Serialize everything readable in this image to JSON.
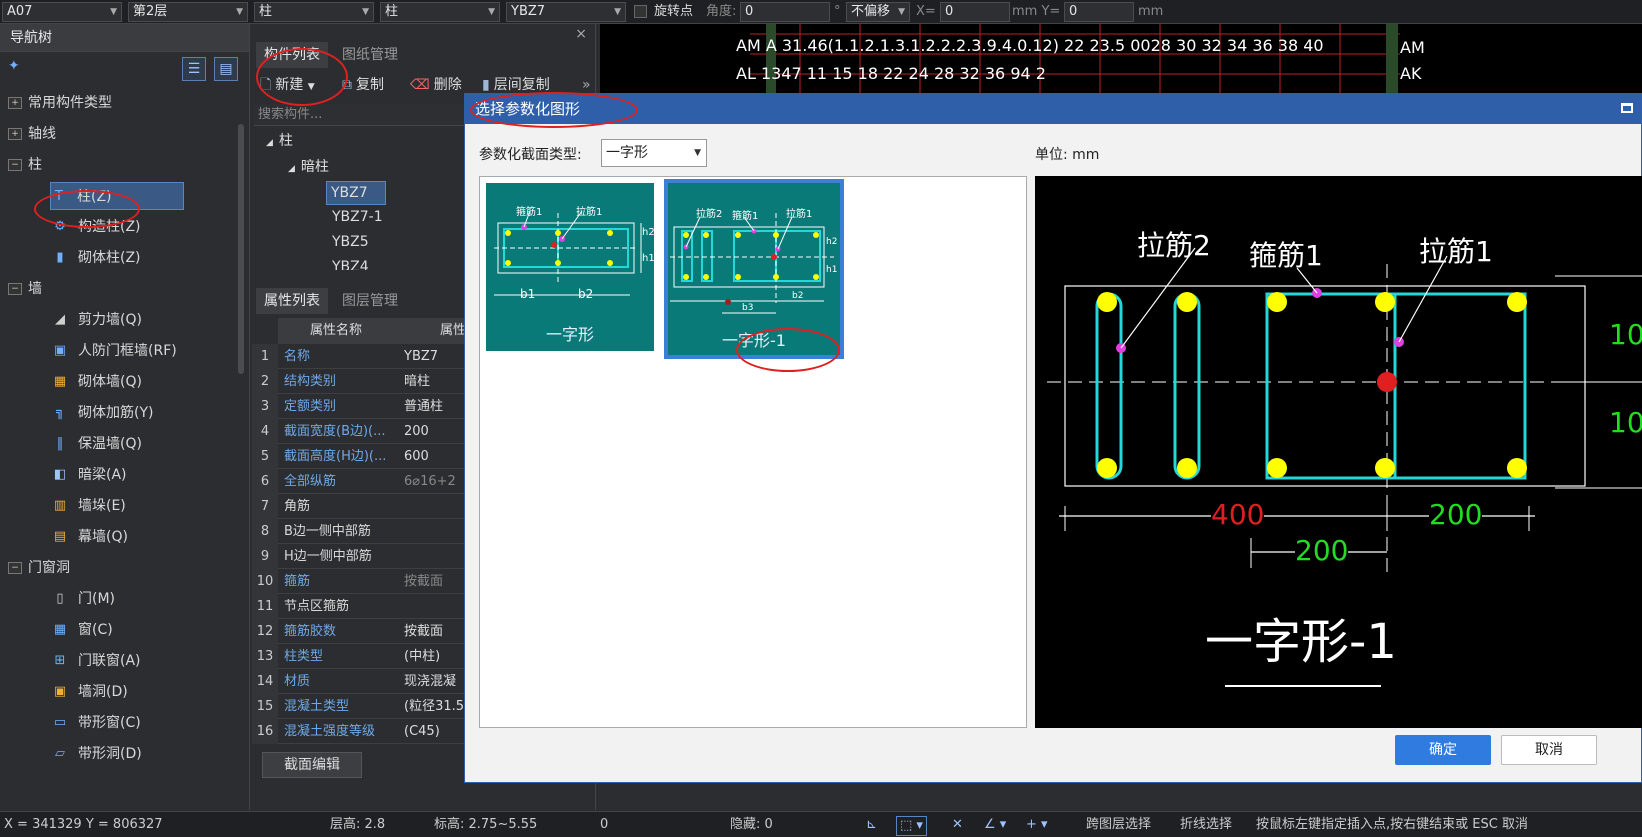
{
  "toolbar": {
    "floor_id": "A07",
    "floor": "第2层",
    "category": "柱",
    "subcategory": "柱",
    "component": "YBZ7",
    "rotate_label": "旋转点",
    "angle_label": "角度:",
    "angle_value": "0",
    "degree": "°",
    "offset_mode": "不偏移",
    "x_label": "X=",
    "x_value": "0",
    "mm_y_label": "mm Y=",
    "y_value": "0",
    "mm": "mm"
  },
  "nav": {
    "title": "导航树",
    "items": [
      {
        "label": "常用构件类型",
        "type": "group"
      },
      {
        "label": "轴线",
        "type": "group"
      },
      {
        "label": "柱",
        "type": "group"
      },
      {
        "label": "柱(Z)",
        "type": "leaf"
      },
      {
        "label": "构造柱(Z)",
        "type": "leaf"
      },
      {
        "label": "砌体柱(Z)",
        "type": "leaf"
      },
      {
        "label": "墙",
        "type": "group"
      },
      {
        "label": "剪力墙(Q)",
        "type": "leaf"
      },
      {
        "label": "人防门框墙(RF)",
        "type": "leaf"
      },
      {
        "label": "砌体墙(Q)",
        "type": "leaf"
      },
      {
        "label": "砌体加筋(Y)",
        "type": "leaf"
      },
      {
        "label": "保温墙(Q)",
        "type": "leaf"
      },
      {
        "label": "暗梁(A)",
        "type": "leaf"
      },
      {
        "label": "墙垛(E)",
        "type": "leaf"
      },
      {
        "label": "幕墙(Q)",
        "type": "leaf"
      },
      {
        "label": "门窗洞",
        "type": "group"
      },
      {
        "label": "门(M)",
        "type": "leaf"
      },
      {
        "label": "窗(C)",
        "type": "leaf"
      },
      {
        "label": "门联窗(A)",
        "type": "leaf"
      },
      {
        "label": "墙洞(D)",
        "type": "leaf"
      },
      {
        "label": "带形窗(C)",
        "type": "leaf"
      },
      {
        "label": "带形洞(D)",
        "type": "leaf"
      }
    ]
  },
  "component_panel": {
    "tab_active": "构件列表",
    "tab_other": "图纸管理",
    "close": "×",
    "btn_new": "新建",
    "btn_copy": "复制",
    "btn_delete": "删除",
    "btn_floor_copy": "层间复制",
    "more": "»",
    "search_placeholder": "搜索构件...",
    "tree_root": "柱",
    "tree_child": "暗柱",
    "items": [
      "YBZ7",
      "YBZ7-1",
      "YBZ5",
      "YBZ4"
    ]
  },
  "property_panel": {
    "tab_active": "属性列表",
    "tab_other": "图层管理",
    "col_name": "属性名称",
    "col_value": "属性",
    "rows": [
      {
        "n": "1",
        "k": "名称",
        "v": "YBZ7"
      },
      {
        "n": "2",
        "k": "结构类别",
        "v": "暗柱"
      },
      {
        "n": "3",
        "k": "定额类别",
        "v": "普通柱"
      },
      {
        "n": "4",
        "k": "截面宽度(B边)(...",
        "v": "200"
      },
      {
        "n": "5",
        "k": "截面高度(H边)(...",
        "v": "600"
      },
      {
        "n": "6",
        "k": "全部纵筋",
        "v": "6⌀16+2"
      },
      {
        "n": "7",
        "k": "角筋",
        "v": ""
      },
      {
        "n": "8",
        "k": "B边一侧中部筋",
        "v": ""
      },
      {
        "n": "9",
        "k": "H边一侧中部筋",
        "v": ""
      },
      {
        "n": "10",
        "k": "箍筋",
        "v": "按截面"
      },
      {
        "n": "11",
        "k": "节点区箍筋",
        "v": ""
      },
      {
        "n": "12",
        "k": "箍筋胶数",
        "v": "按截面"
      },
      {
        "n": "13",
        "k": "柱类型",
        "v": "(中柱)"
      },
      {
        "n": "14",
        "k": "材质",
        "v": "现浇混凝"
      },
      {
        "n": "15",
        "k": "混凝土类型",
        "v": "(粒径31.5"
      },
      {
        "n": "16",
        "k": "混凝土强度等级",
        "v": "(C45)"
      }
    ],
    "section_edit": "截面编辑"
  },
  "drawing": {
    "row1": "AM  A  31.46(1.1.2.1.3.1.2.2.2.3.9.4.0.12) 22 23.5 0028 30 32 34 36 38 40",
    "row2": "AL    1347 11 15 18 22 24 28 32 36 94 2",
    "marker1": "AM",
    "marker2": "AK"
  },
  "dialog": {
    "title": "选择参数化图形",
    "section_type_label": "参数化截面类型:",
    "section_type_value": "一字形",
    "unit_label": "单位:  mm",
    "shapes": [
      {
        "name": "一字形",
        "labels": [
          "箍筋1",
          "拉筋1",
          "b1",
          "b2",
          "h1",
          "h2"
        ]
      },
      {
        "name": "一字形-1",
        "labels": [
          "拉筋2",
          "箍筋1",
          "拉筋1",
          "b3",
          "b2",
          "h2",
          "h1"
        ]
      }
    ],
    "preview": {
      "label_tie2": "拉筋2",
      "label_stirrup1": "箍筋1",
      "label_tie1": "拉筋1",
      "dim_400": "400",
      "dim_200a": "200",
      "dim_200b": "200",
      "dim_right1": "10",
      "dim_right2": "10",
      "name": "一字形-1"
    },
    "ok": "确定",
    "cancel": "取消"
  },
  "status": {
    "coords": "X = 341329 Y = 806327",
    "floor_height": "层高:   2.8",
    "elevation": "标高:   2.75~5.55",
    "zero": "0",
    "hidden": "隐藏: 0",
    "cross_floor": "跨图层选择",
    "polyline": "折线选择",
    "hint": "按鼠标左键指定插入点,按右键结束或 ESC 取消"
  },
  "colors": {
    "accent": "#2e5fa8",
    "teal": "#0a7a78",
    "rebar_cyan": "#22d8d8",
    "dot_yellow": "#ffff00",
    "dim_red": "#e02020",
    "dim_green": "#22dd22"
  }
}
